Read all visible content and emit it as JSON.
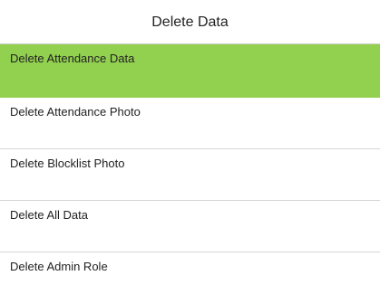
{
  "header": {
    "title": "Delete Data"
  },
  "menu": {
    "items": [
      {
        "label": "Delete Attendance Data",
        "selected": true
      },
      {
        "label": "Delete Attendance Photo",
        "selected": false
      },
      {
        "label": "Delete Blocklist Photo",
        "selected": false
      },
      {
        "label": "Delete All Data",
        "selected": false
      },
      {
        "label": "Delete Admin Role",
        "selected": false
      }
    ]
  },
  "colors": {
    "selected_background": "#92d050",
    "divider": "#d4d4d4"
  }
}
